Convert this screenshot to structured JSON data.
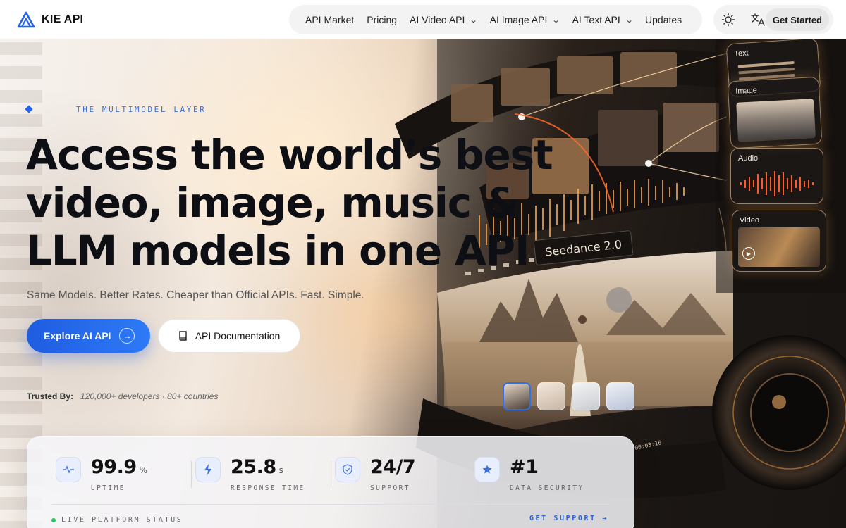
{
  "nav": {
    "logo_text": "KIE API",
    "menu": [
      {
        "label": "API Market",
        "dropdown": false
      },
      {
        "label": "Pricing",
        "dropdown": false
      },
      {
        "label": "AI Video API",
        "dropdown": true
      },
      {
        "label": "AI Image API",
        "dropdown": true
      },
      {
        "label": "AI Text API",
        "dropdown": true
      },
      {
        "label": "Updates",
        "dropdown": false
      }
    ],
    "theme_icon": "sun-icon",
    "language_icon": "translate-icon",
    "cta_label": "Get Started"
  },
  "hero": {
    "eyebrow": "THE MULTIMODEL LAYER",
    "headline": [
      "Access the world’s best",
      "video, image, music &",
      "LLM models in one API"
    ],
    "subheadline": "Same Models. Better Rates. Cheaper than Official APIs. Fast. Simple.",
    "primary_button": "Explore AI API",
    "secondary_button": "API Documentation",
    "trusted_label": "Trusted By:",
    "trusted_value": "120,000+ developers · 80+ countries"
  },
  "showcase": {
    "model_label": "Seedance 2.0",
    "cards": [
      "Text",
      "Image",
      "Audio",
      "Video"
    ],
    "timecode": "00:03:16"
  },
  "stats": {
    "items": [
      {
        "value": "99.9",
        "unit": "%",
        "label": "UPTIME",
        "icon": "pulse-icon"
      },
      {
        "value": "25.8",
        "unit": "s",
        "label": "RESPONSE TIME",
        "icon": "bolt-icon"
      },
      {
        "value": "24/7",
        "unit": "",
        "label": "SUPPORT",
        "icon": "shield-icon"
      },
      {
        "value": "#1",
        "unit": "",
        "label": "DATA SECURITY",
        "icon": "star-icon"
      }
    ],
    "status_label": "LIVE PLATFORM STATUS",
    "support_link": "GET SUPPORT →"
  },
  "colors": {
    "accent": "#2563eb",
    "status_ok": "#22c55e"
  }
}
